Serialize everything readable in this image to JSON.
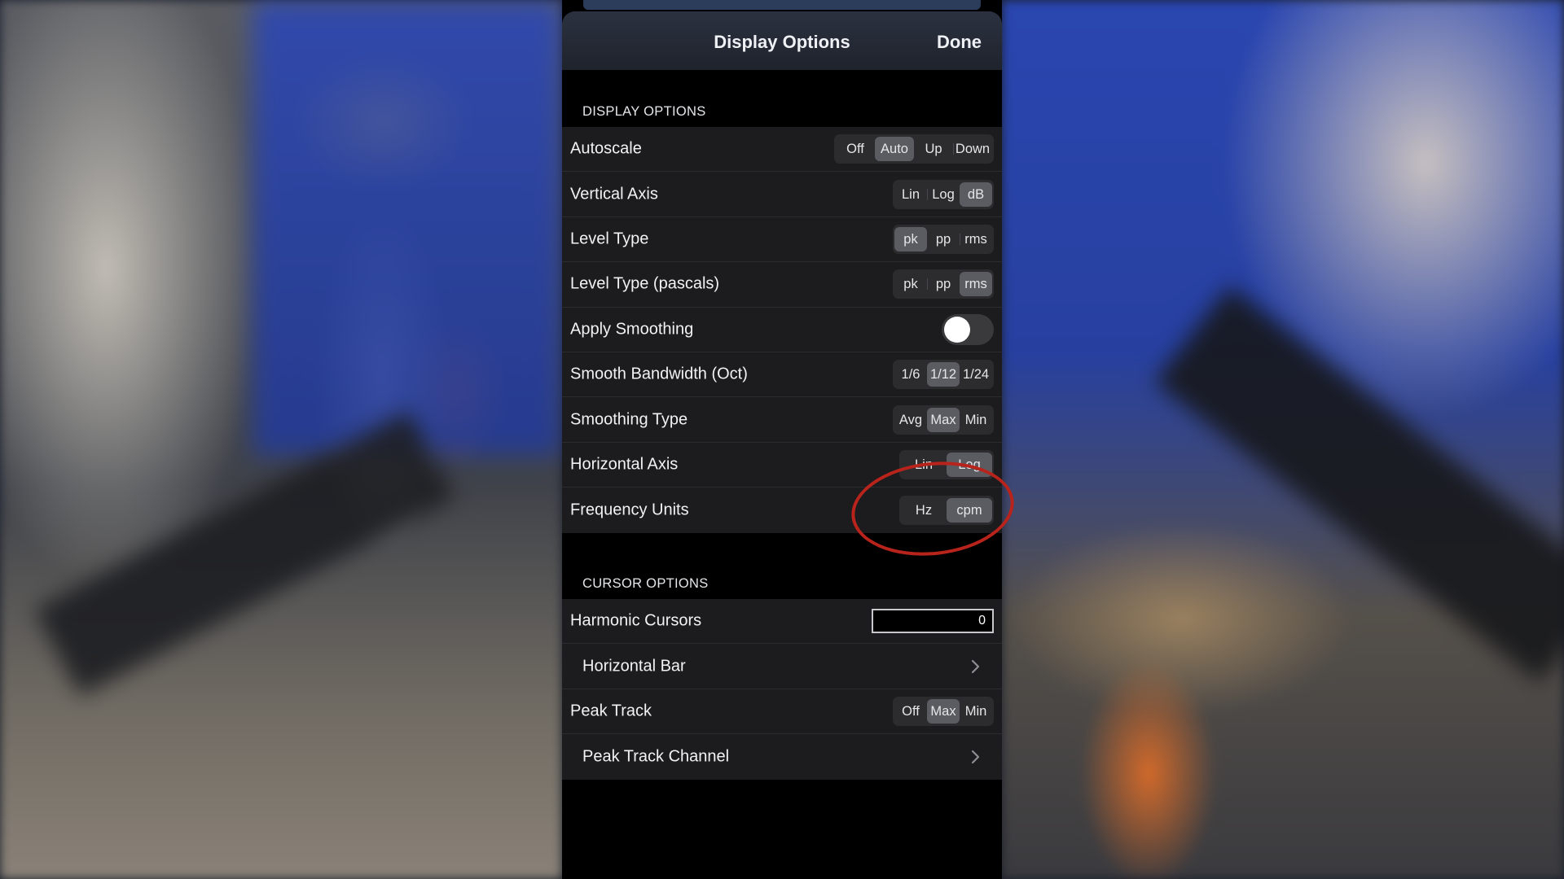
{
  "nav": {
    "title": "Display Options",
    "done_label": "Done"
  },
  "display_options": {
    "header": "DISPLAY OPTIONS",
    "rows": [
      {
        "label": "Autoscale",
        "options": [
          "Off",
          "Auto",
          "Up",
          "Down"
        ],
        "selected": "Auto"
      },
      {
        "label": "Vertical Axis",
        "options": [
          "Lin",
          "Log",
          "dB"
        ],
        "selected": "dB"
      },
      {
        "label": "Level Type",
        "options": [
          "pk",
          "pp",
          "rms"
        ],
        "selected": "pk"
      },
      {
        "label": "Level Type (pascals)",
        "options": [
          "pk",
          "pp",
          "rms"
        ],
        "selected": "rms"
      },
      {
        "label": "Apply Smoothing",
        "toggle": false
      },
      {
        "label": "Smooth Bandwidth (Oct)",
        "options": [
          "1/6",
          "1/12",
          "1/24"
        ],
        "selected": "1/12"
      },
      {
        "label": "Smoothing Type",
        "options": [
          "Avg",
          "Max",
          "Min"
        ],
        "selected": "Max"
      },
      {
        "label": "Horizontal Axis",
        "options": [
          "Lin",
          "Log"
        ],
        "selected": "Log"
      },
      {
        "label": "Frequency Units",
        "options": [
          "Hz",
          "cpm"
        ],
        "selected": "cpm"
      }
    ]
  },
  "cursor_options": {
    "header": "CURSOR OPTIONS",
    "harmonic_cursors": {
      "label": "Harmonic Cursors",
      "value": "0"
    },
    "horizontal_bar": {
      "label": "Horizontal Bar"
    },
    "peak_track": {
      "label": "Peak Track",
      "options": [
        "Off",
        "Max",
        "Min"
      ],
      "selected": "Max"
    },
    "peak_track_channel": {
      "label": "Peak Track Channel"
    }
  },
  "colors": {
    "selected_segment": "#5b5c62",
    "highlight_circle": "#b8241b"
  }
}
